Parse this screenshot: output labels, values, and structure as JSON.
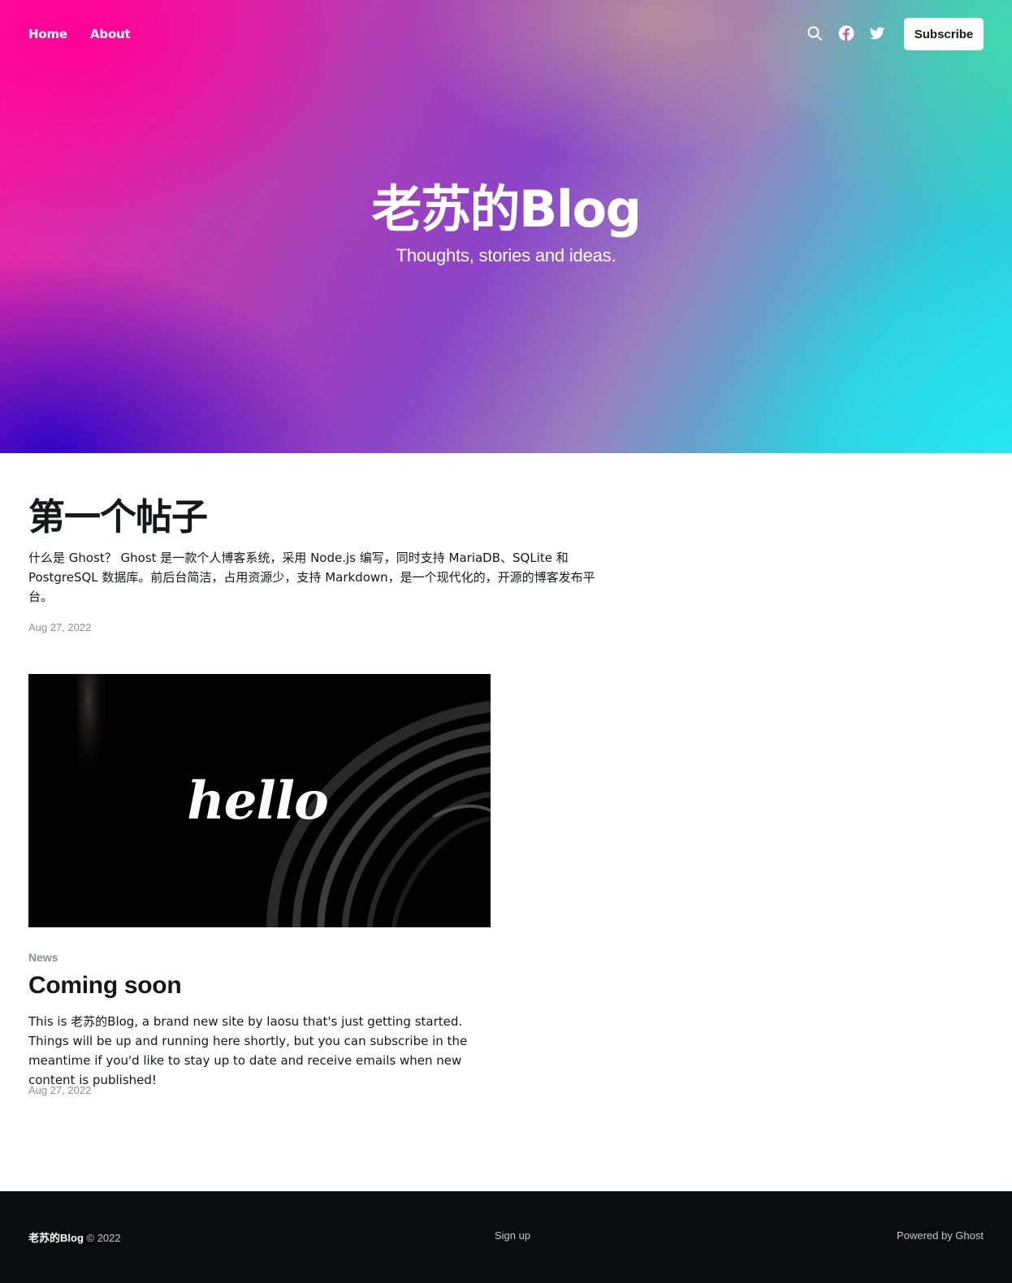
{
  "nav": {
    "home_label": "Home",
    "about_label": "About",
    "subscribe_label": "Subscribe",
    "icons": [
      "search-icon",
      "facebook-icon",
      "twitter-icon"
    ]
  },
  "hero": {
    "title": "老苏的Blog",
    "description": "Thoughts, stories and ideas."
  },
  "posts": [
    {
      "title": "第一个帖子",
      "excerpt": "什么是 Ghost？ Ghost 是一款个人博客系统，采用 Node.js 编写，同时支持 MariaDB、SQLite 和 PostgreSQL 数据库。前后台简洁，占用资源少，支持 Markdown，是一个现代化的，开源的博客发布平台。",
      "date": "Aug 27, 2022"
    },
    {
      "tag": "News",
      "title": "Coming soon",
      "image_text": "hello",
      "excerpt": "This is 老苏的Blog, a brand new site by laosu that's just getting started. Things will be up and running here shortly, but you can subscribe in the meantime if you'd like to stay up to date and receive emails when new content is published!",
      "date": "Aug 27, 2022"
    }
  ],
  "footer": {
    "brand": "老苏的Blog",
    "copyright": "© 2022",
    "signup_label": "Sign up",
    "powered_label": "Powered by Ghost"
  },
  "colors": {
    "text": "#15171a",
    "muted": "#8b8e93",
    "footer_bg": "#0b0c0e",
    "accent_pink": "#ff1aa0",
    "accent_cyan": "#20d8e8"
  }
}
